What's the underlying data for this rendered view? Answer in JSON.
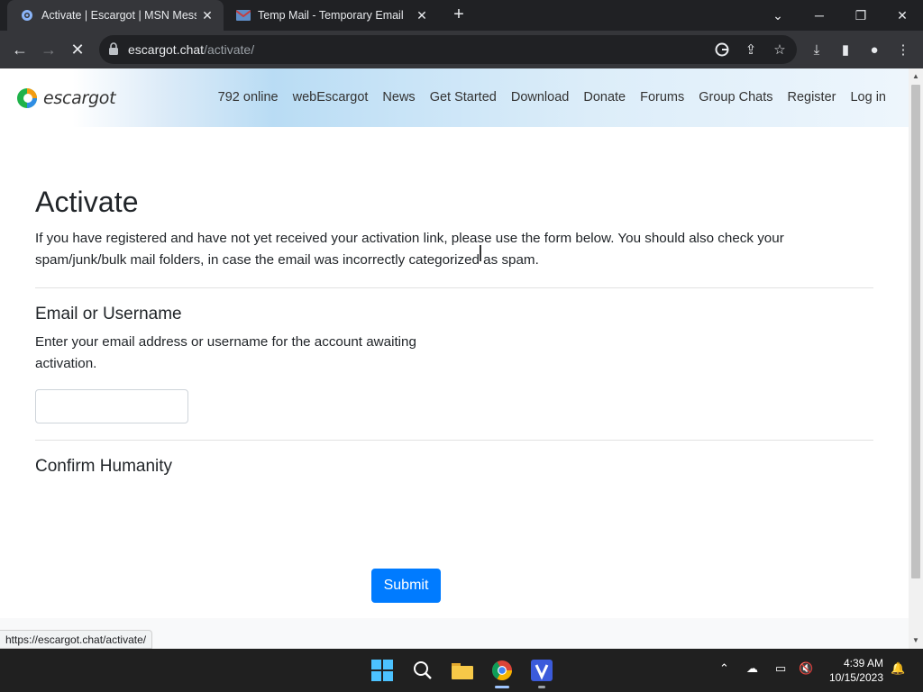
{
  "browser": {
    "tabs": [
      {
        "title": "Activate | Escargot | MSN Messe",
        "active": true
      },
      {
        "title": "Temp Mail - Temporary Email",
        "active": false
      }
    ],
    "url_host": "escargot.chat",
    "url_path": "/activate/",
    "status_url": "https://escargot.chat/activate/"
  },
  "site": {
    "logo_text": "escargot",
    "nav": [
      "792 online",
      "webEscargot",
      "News",
      "Get Started",
      "Download",
      "Donate",
      "Forums",
      "Group Chats",
      "Register",
      "Log in"
    ]
  },
  "page": {
    "title": "Activate",
    "intro": "If you have registered and have not yet received your activation link, please use the form below. You should also check your spam/junk/bulk mail folders, in case the email was incorrectly categorized as spam.",
    "email_heading": "Email or Username",
    "email_help": "Enter your email address or username for the account awaiting activation.",
    "email_value": "",
    "humanity_heading": "Confirm Humanity",
    "submit_label": "Submit"
  },
  "taskbar": {
    "time": "4:39 AM",
    "date": "10/15/2023",
    "accent": "#0078d4"
  }
}
